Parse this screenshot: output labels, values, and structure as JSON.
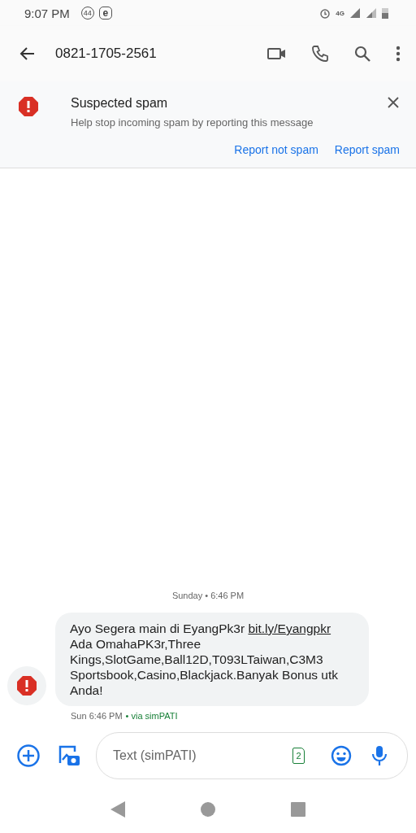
{
  "status_bar": {
    "time": "9:07 PM",
    "badge": "44",
    "app_letter": "e",
    "network": "4G"
  },
  "toolbar": {
    "title": "0821-1705-2561"
  },
  "spam_banner": {
    "title": "Suspected spam",
    "body": "Help stop incoming spam by reporting this message",
    "actions": [
      "Report not spam",
      "Report spam"
    ]
  },
  "conversation": {
    "date_header": "Sunday • 6:46 PM",
    "message": {
      "text_before": "Ayo Segera main di EyangPk3r ",
      "link": "bit.ly/Eyangpkr",
      "text_after": " Ada OmahaPK3r,Three Kings,SlotGame,Ball12D,T093LTaiwan,C3M3 Sportsbook,Casino,Blackjack.Banyak Bonus utk Anda!",
      "time": "Sun 6:46 PM",
      "via": "• via simPATI"
    }
  },
  "compose": {
    "placeholder": "Text (simPATI)",
    "sim": "2"
  }
}
